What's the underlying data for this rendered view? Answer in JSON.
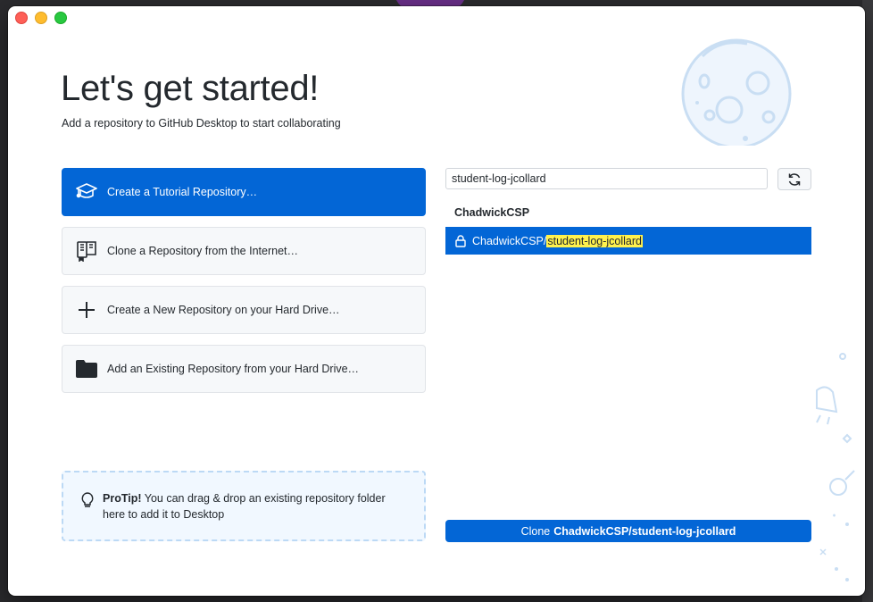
{
  "window": {
    "title": "Let's get started!",
    "subtitle": "Add a repository to GitHub Desktop to start collaborating"
  },
  "actions": [
    {
      "label": "Create a Tutorial Repository…",
      "icon": "mortarboard-icon"
    },
    {
      "label": "Clone a Repository from the Internet…",
      "icon": "repo-clone-icon"
    },
    {
      "label": "Create a New Repository on your Hard Drive…",
      "icon": "plus-icon"
    },
    {
      "label": "Add an Existing Repository from your Hard Drive…",
      "icon": "folder-icon"
    }
  ],
  "protip": {
    "bold": "ProTip!",
    "text": "You can drag & drop an existing repository folder here to add it to Desktop"
  },
  "clone_panel": {
    "search_value": "student-log-jcollard",
    "group_header": "ChadwickCSP",
    "selected_repo": {
      "owner_prefix": "ChadwickCSP/",
      "name_highlight": "student-log-jcollard"
    },
    "clone_button_prefix": "Clone",
    "clone_button_repo": "ChadwickCSP/student-log-jcollard"
  },
  "colors": {
    "accent": "#0366d6",
    "highlight": "#fff14d",
    "protip_bg": "#f1f8ff"
  }
}
